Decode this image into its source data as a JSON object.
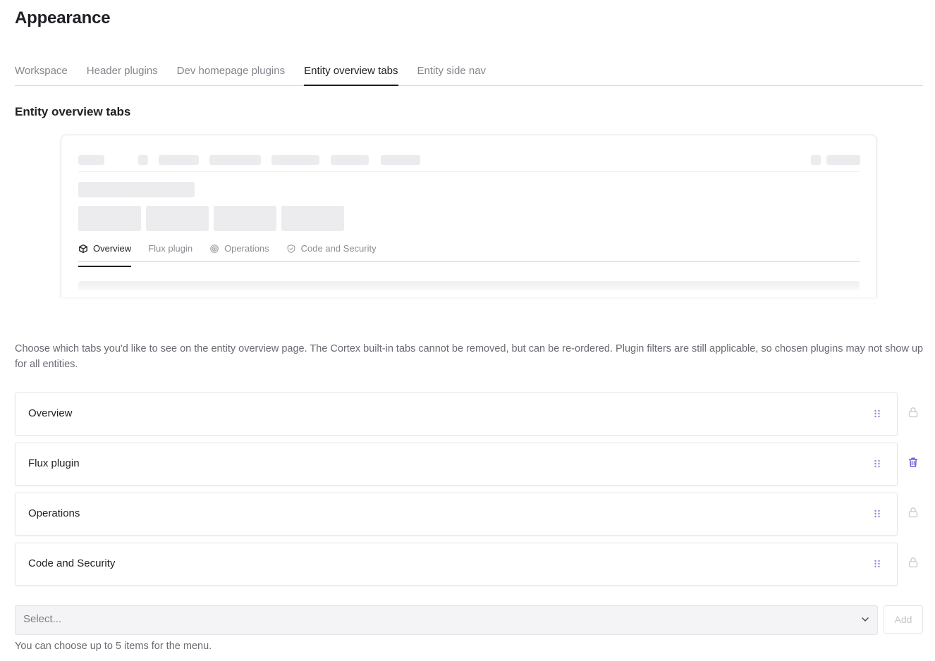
{
  "page": {
    "title": "Appearance"
  },
  "tabs": [
    {
      "label": "Workspace",
      "active": false
    },
    {
      "label": "Header plugins",
      "active": false
    },
    {
      "label": "Dev homepage plugins",
      "active": false
    },
    {
      "label": "Entity overview tabs",
      "active": true
    },
    {
      "label": "Entity side nav",
      "active": false
    }
  ],
  "section": {
    "title": "Entity overview tabs"
  },
  "preview": {
    "tabs": [
      {
        "label": "Overview",
        "icon": "cube-icon",
        "active": true
      },
      {
        "label": "Flux plugin",
        "icon": "",
        "active": false
      },
      {
        "label": "Operations",
        "icon": "target-icon",
        "active": false
      },
      {
        "label": "Code and Security",
        "icon": "shield-icon",
        "active": false
      }
    ]
  },
  "description": "Choose which tabs you'd like to see on the entity overview page. The Cortex built-in tabs cannot be removed, but can be re-ordered. Plugin filters are still applicable, so chosen plugins may not show up for all entities.",
  "tab_list": [
    {
      "label": "Overview",
      "action_icon": "lock-icon",
      "removable": false
    },
    {
      "label": "Flux plugin",
      "action_icon": "trash-icon",
      "removable": true
    },
    {
      "label": "Operations",
      "action_icon": "lock-icon",
      "removable": false
    },
    {
      "label": "Code and Security",
      "action_icon": "lock-icon",
      "removable": false
    }
  ],
  "select": {
    "placeholder": "Select...",
    "icon": "chevron-down-icon"
  },
  "add_button": {
    "label": "Add",
    "disabled": true
  },
  "help_text": "You can choose up to 5 items for the menu.",
  "colors": {
    "text_primary": "#1f1f24",
    "text_muted": "#85858c",
    "accent_trash": "#6b5fd6",
    "lock_icon": "#c9c9ce",
    "skeleton": "#ececef",
    "border": "#e3e3e8"
  }
}
